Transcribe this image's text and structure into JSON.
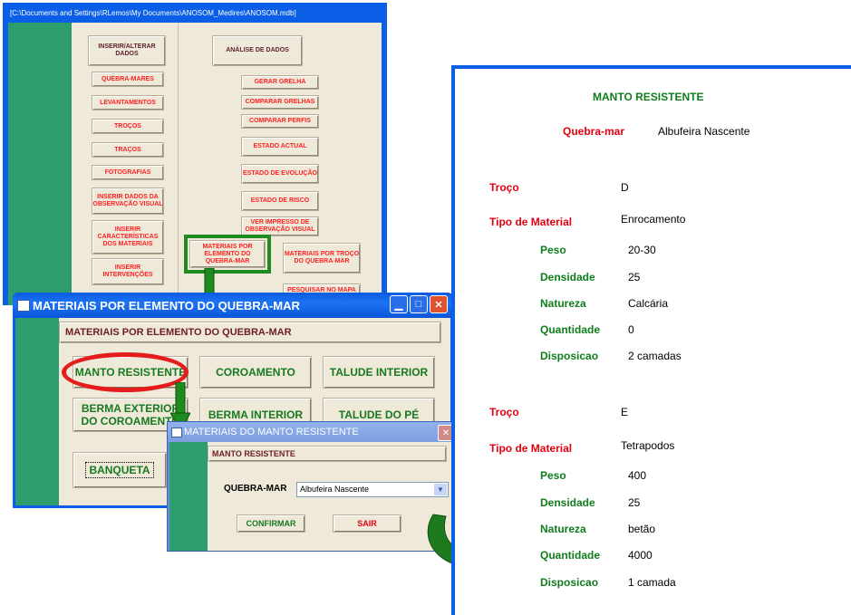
{
  "main_window": {
    "title": "[C:\\Documents and Settings\\RLemos\\My Documents\\ANOSOM_Medires\\ANOSOM.mdb]",
    "left_header": "INSERIR/ALTERAR DADOS",
    "left_buttons": [
      "QUEBRA-MARES",
      "LEVANTAMENTOS",
      "TROÇOS",
      "TRAÇOS",
      "FOTOGRAFIAS",
      "INSERIR DADOS DA OBSERVAÇÃO VISUAL",
      "INSERIR CARACTERÍSTICAS DOS MATERIAIS",
      "INSERIR INTERVENÇÕES"
    ],
    "right_header": "ANÁLISE DE DADOS",
    "right_buttons": [
      "GERAR GRELHA",
      "COMPARAR GRELHAS",
      "COMPARAR PERFIS",
      "ESTADO ACTUAL",
      "ESTADO DE EVOLUÇÃO",
      "ESTADO DE RISCO",
      "VER IMPRESSO DE OBSERVAÇÃO VISUAL"
    ],
    "materiais_elemento": "MATERIAIS POR ELEMENTO DO QUEBRA-MAR",
    "materiais_troco": "MATERIAIS POR TROÇO DO QUEBRA-MAR",
    "pesquisar_mapa": "PESQUISAR NO MAPA"
  },
  "elem_window": {
    "title": "MATERIAIS POR ELEMENTO DO QUEBRA-MAR",
    "header": "MATERIAIS POR ELEMENTO DO QUEBRA-MAR",
    "buttons": {
      "manto": "MANTO RESISTENTE",
      "coroamento": "COROAMENTO",
      "talude_interior": "TALUDE INTERIOR",
      "berma_exterior": "BERMA EXTERIOR DO COROAMENTO",
      "berma_interior": "BERMA INTERIOR",
      "talude_pe": "TALUDE DO PÉ",
      "banqueta": "BANQUETA"
    }
  },
  "manto_window": {
    "title": "MATERIAIS DO MANTO RESISTENTE",
    "header": "MANTO RESISTENTE",
    "field_label": "QUEBRA-MAR",
    "field_value": "Albufeira Nascente",
    "confirm": "CONFIRMAR",
    "exit": "SAIR"
  },
  "report": {
    "title": "MANTO RESISTENTE",
    "quebra_mar_label": "Quebra-mar",
    "quebra_mar_value": "Albufeira Nascente",
    "troco_label": "Troço",
    "tipo_label": "Tipo de Material",
    "peso_label": "Peso",
    "densidade_label": "Densidade",
    "natureza_label": "Natureza",
    "quantidade_label": "Quantidade",
    "disposicao_label": "Disposicao",
    "sections": [
      {
        "troco": "D",
        "tipo": "Enrocamento",
        "peso": "20-30",
        "densidade": "25",
        "natureza": "Calcária",
        "quantidade": "0",
        "disposicao": "2 camadas"
      },
      {
        "troco": "E",
        "tipo": "Tetrapodos",
        "peso": "400",
        "densidade": "25",
        "natureza": "betão",
        "quantidade": "4000",
        "disposicao": "1 camada"
      }
    ]
  },
  "colors": {
    "xp_blue": "#0b5fe6",
    "access_green": "#2d9d6e",
    "beige": "#efe9d9",
    "highlight_red": "#e41c1c",
    "arrow_green": "#1e7a1e"
  }
}
